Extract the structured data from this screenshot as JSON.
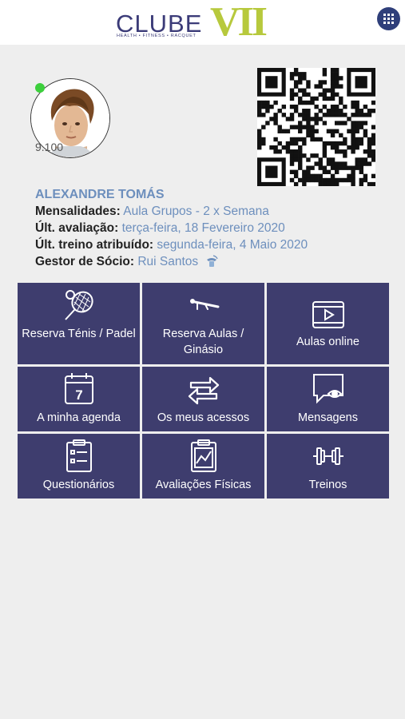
{
  "header": {
    "logo_text": "CLUBE",
    "logo_mark": "VII",
    "logo_tagline": "HEALTH • FITNESS • RACQUET",
    "menu_icon": "grid-menu-icon"
  },
  "profile": {
    "status": "online",
    "points": "9.100",
    "name": "ALEXANDRE TOMÁS",
    "rows": [
      {
        "label": "Mensalidades:",
        "value": "Aula Grupos - 2 x Semana"
      },
      {
        "label": "Últ. avaliação:",
        "value": "terça-feira, 18 Fevereiro 2020"
      },
      {
        "label": "Últ. treino atribuído:",
        "value": "segunda-feira, 4 Maio 2020"
      },
      {
        "label": "Gestor de Sócio:",
        "value": "Rui Santos"
      }
    ]
  },
  "tiles": [
    {
      "label": "Reserva Ténis / Padel",
      "icon": "tennis-racket-icon"
    },
    {
      "label": "Reserva Aulas / Ginásio",
      "icon": "pushup-icon"
    },
    {
      "label": "Aulas online",
      "icon": "video-play-icon"
    },
    {
      "label": "A minha agenda",
      "icon": "calendar-icon",
      "day": "7"
    },
    {
      "label": "Os meus acessos",
      "icon": "arrows-exchange-icon"
    },
    {
      "label": "Mensagens",
      "icon": "message-eye-icon"
    },
    {
      "label": "Questionários",
      "icon": "clipboard-list-icon"
    },
    {
      "label": "Avaliações Físicas",
      "icon": "clipboard-chart-icon"
    },
    {
      "label": "Treinos",
      "icon": "dumbbell-icon"
    }
  ],
  "colors": {
    "tile_bg": "#3e3d6e",
    "accent_link": "#6d8fbd",
    "logo_green": "#b7c93d",
    "logo_navy": "#3b3b78",
    "online": "#3ccf3c"
  }
}
